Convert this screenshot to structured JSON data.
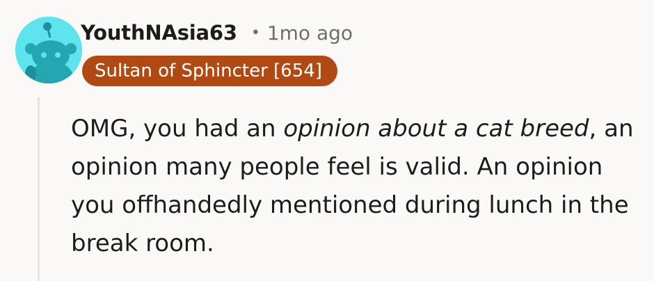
{
  "comment": {
    "author": "YouthNAsia63",
    "separator": "•",
    "timestamp": "1mo ago",
    "flair": "Sultan of Sphincter [654]",
    "body": {
      "text_before_emphasis": "OMG, you had an ",
      "emphasis": "opinion about a cat breed",
      "text_after_emphasis": ", an opinion many people feel is valid. An opinion you offhandedly mentioned during lunch in the break room."
    }
  },
  "colors": {
    "avatar_background": "#5fe3ef",
    "avatar_figure": "#25a7b2",
    "flair_background": "#b04a12",
    "flair_text": "#ffffff",
    "thread_line": "#e7e2df"
  },
  "icons": {
    "avatar": "default-snoo-avatar-icon"
  }
}
